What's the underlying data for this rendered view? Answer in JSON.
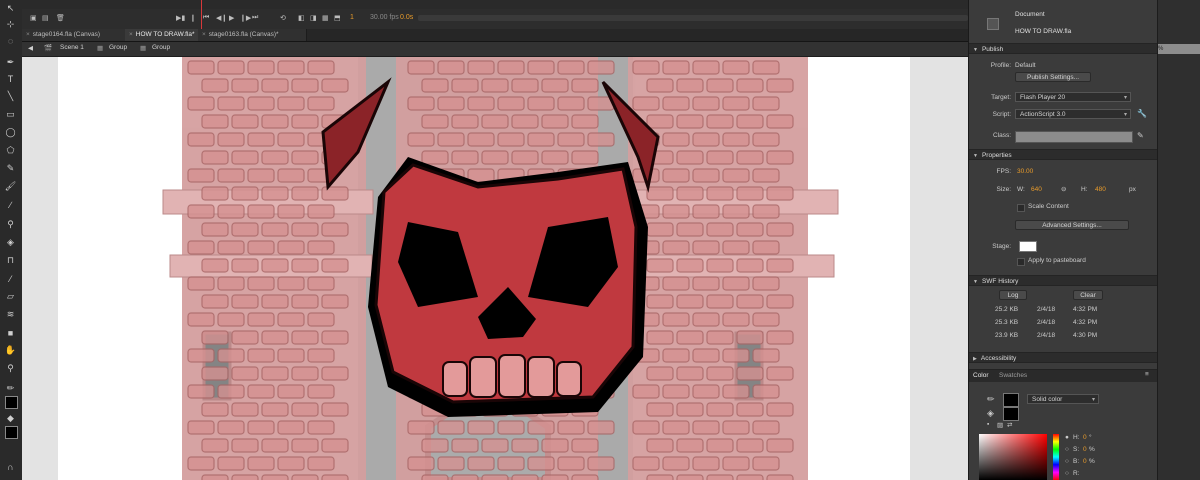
{
  "timeline": {
    "frame_number": "1",
    "fps_readout": "30.00 fps",
    "time_readout": "0.0s"
  },
  "tabs": [
    {
      "label": "stage0164.fla (Canvas)"
    },
    {
      "label": "HOW TO DRAW.fla*"
    },
    {
      "label": "stage0163.fla (Canvas)*"
    }
  ],
  "breadcrumb": {
    "scene": "Scene 1",
    "group1": "Group",
    "group2": "Group"
  },
  "panel": {
    "document": {
      "title": "Document",
      "filename": "HOW TO DRAW.fla"
    },
    "zoom_fragment": "%",
    "publish": {
      "header": "Publish",
      "profile_label": "Profile:",
      "profile_value": "Default",
      "settings_button": "Publish Settings...",
      "target_label": "Target:",
      "target_value": "Flash Player 20",
      "script_label": "Script:",
      "script_value": "ActionScript 3.0",
      "class_label": "Class:"
    },
    "properties": {
      "header": "Properties",
      "fps_label": "FPS:",
      "fps_value": "30.00",
      "size_label": "Size:",
      "w_label": "W:",
      "w_value": "640",
      "h_label": "H:",
      "h_value": "480",
      "unit": "px",
      "scale_content": "Scale Content",
      "advanced_button": "Advanced Settings...",
      "stage_label": "Stage:",
      "pasteboard": "Apply to pasteboard"
    },
    "swf_history": {
      "header": "SWF History",
      "log_button": "Log",
      "clear_button": "Clear",
      "rows": [
        {
          "size": "25.2 KB",
          "date": "2/4/18",
          "time": "4:32 PM"
        },
        {
          "size": "25.3 KB",
          "date": "2/4/18",
          "time": "4:32 PM"
        },
        {
          "size": "23.9 KB",
          "date": "2/4/18",
          "time": "4:30 PM"
        }
      ]
    },
    "accessibility": {
      "header": "Accessibility"
    },
    "color": {
      "tab_color": "Color",
      "tab_swatches": "Swatches",
      "type_value": "Solid color",
      "h_label": "H:",
      "h_value": "0",
      "s_label": "S:",
      "s_value": "0",
      "b_label": "B:",
      "b_value": "0",
      "r_label": "R:",
      "deg": "°",
      "pct1": "%",
      "pct2": "%"
    }
  },
  "colors": {
    "accent": "#e89b2b",
    "skull": "#c0393f",
    "brick": "#c98585"
  }
}
